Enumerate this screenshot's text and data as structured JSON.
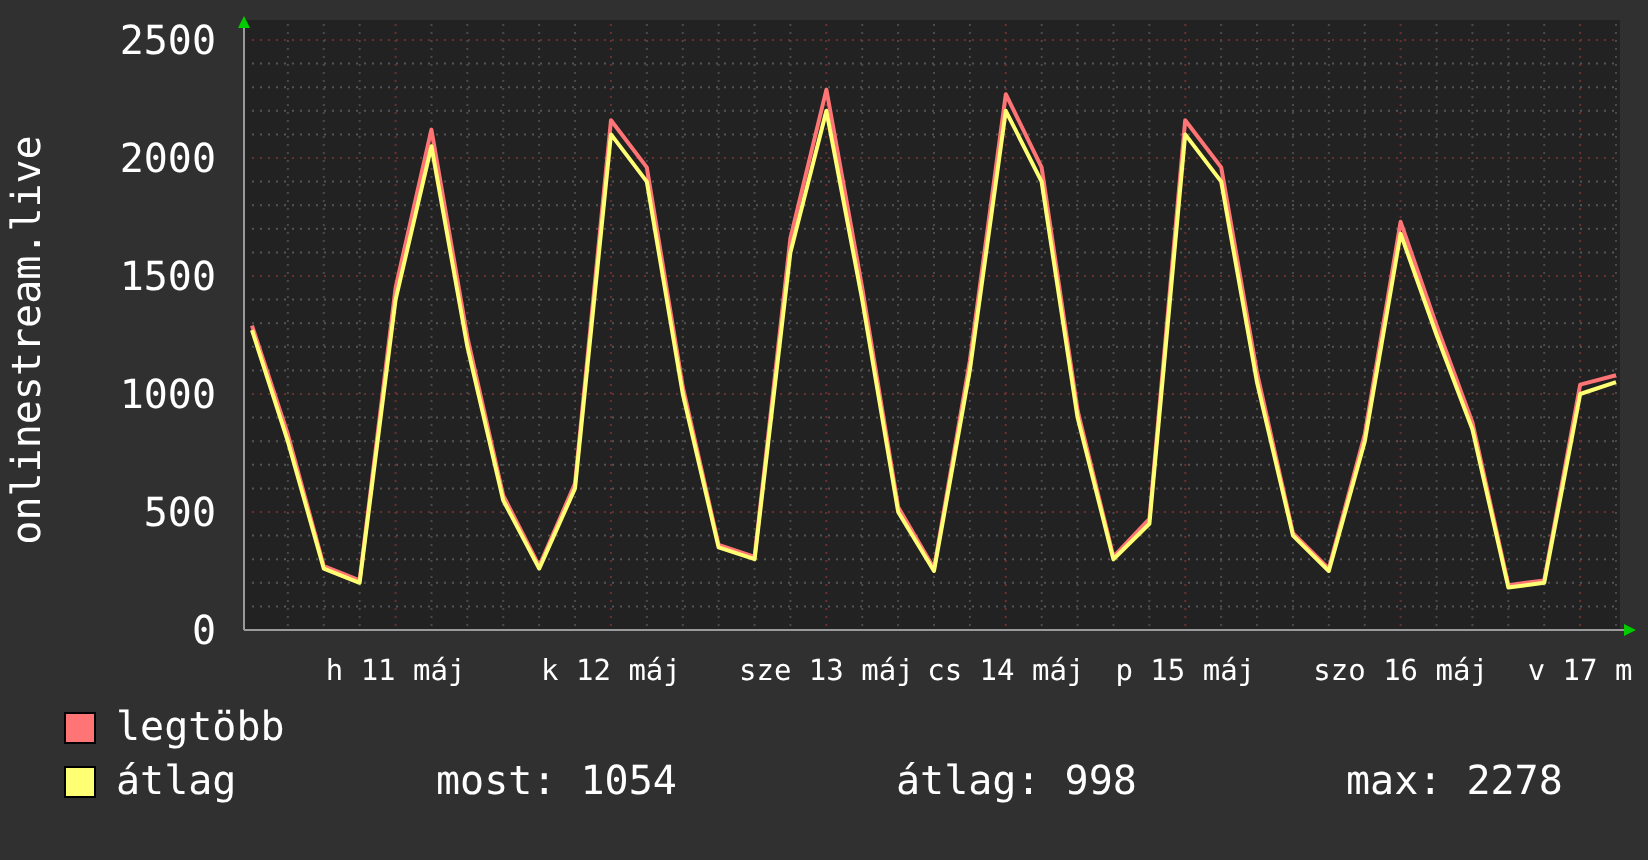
{
  "chart": {
    "chart_data": {
      "type": "line",
      "ylabel": "onlinestream.live",
      "categories": [
        null,
        null,
        null,
        null,
        "h 11 máj",
        null,
        null,
        null,
        null,
        null,
        "k 12 máj",
        null,
        null,
        null,
        null,
        null,
        "sze 13 máj",
        null,
        null,
        null,
        null,
        "cs 14 máj",
        null,
        null,
        null,
        null,
        "p 15 máj",
        null,
        null,
        null,
        null,
        null,
        "szo 16 máj",
        null,
        null,
        null,
        null,
        "v 17 m",
        null
      ],
      "grid": true,
      "ylim": [
        0,
        2500
      ],
      "yticks": [
        0,
        500,
        1000,
        1500,
        2000,
        2500
      ],
      "series": [
        {
          "name": "legtöbb",
          "color": "#ff7474",
          "values": [
            1290,
            830,
            270,
            210,
            1450,
            2120,
            1240,
            570,
            270,
            620,
            2160,
            1960,
            1030,
            360,
            310,
            1660,
            2290,
            1450,
            520,
            260,
            1140,
            2270,
            1960,
            930,
            310,
            470,
            2160,
            1960,
            1090,
            410,
            260,
            830,
            1730,
            1290,
            880,
            190,
            210,
            1040,
            1080
          ]
        },
        {
          "name": "átlag",
          "color": "#ffff74",
          "values": [
            1270,
            800,
            260,
            200,
            1400,
            2050,
            1200,
            550,
            260,
            600,
            2100,
            1900,
            1000,
            350,
            300,
            1600,
            2200,
            1400,
            500,
            250,
            1100,
            2200,
            1900,
            900,
            300,
            450,
            2100,
            1900,
            1050,
            400,
            250,
            800,
            1680,
            1250,
            850,
            180,
            200,
            1000,
            1050
          ]
        }
      ]
    }
  },
  "stats": [
    "most: 1054",
    "átlag: 998",
    "max: 2278"
  ]
}
